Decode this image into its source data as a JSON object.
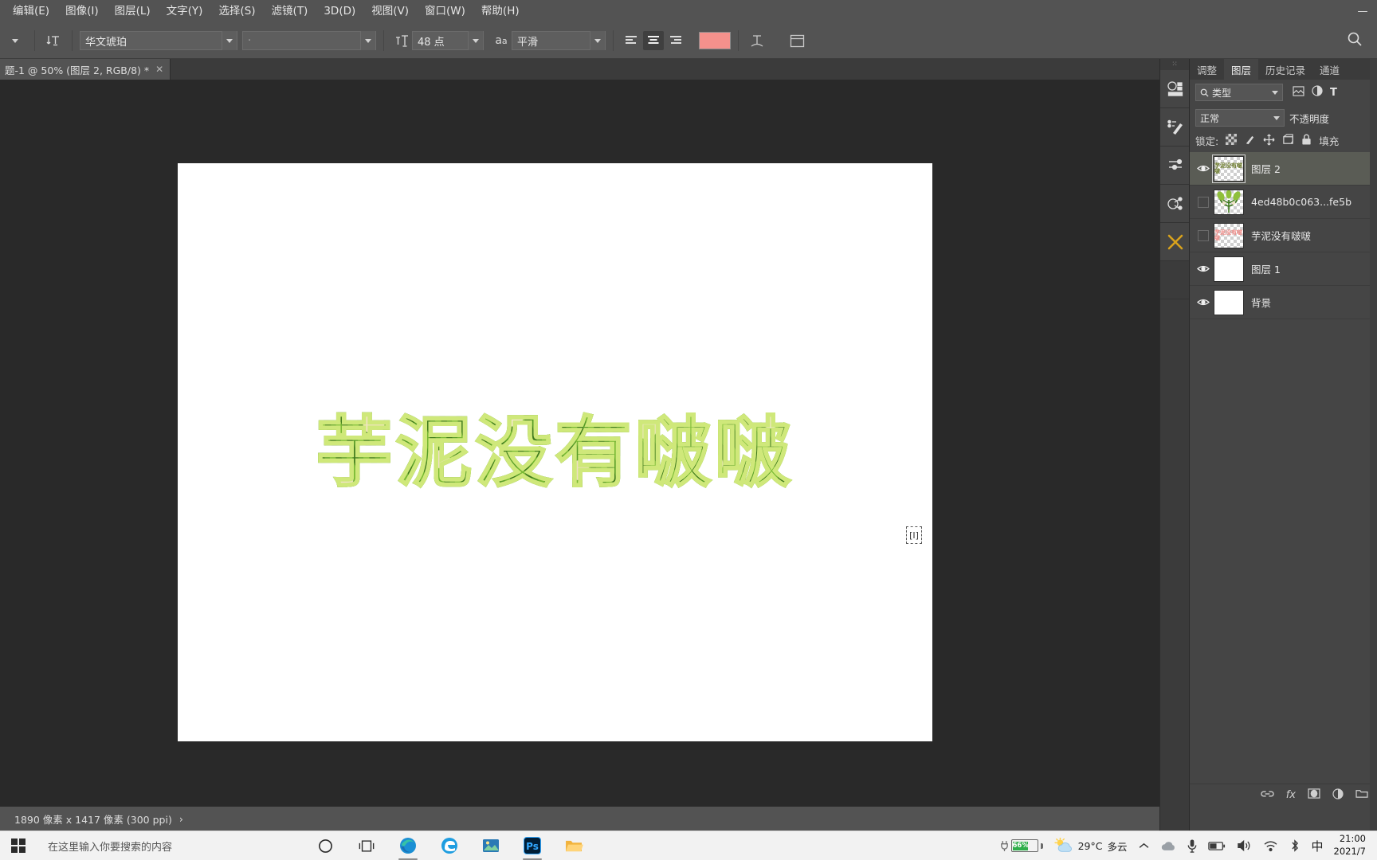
{
  "app": {
    "name": "Adobe Photoshop",
    "theme_bg": "#535353",
    "canvas_bg": "#292929"
  },
  "menubar": {
    "items": [
      {
        "label": "编辑(E)",
        "name": "menu-edit"
      },
      {
        "label": "图像(I)",
        "name": "menu-image"
      },
      {
        "label": "图层(L)",
        "name": "menu-layer"
      },
      {
        "label": "文字(Y)",
        "name": "menu-type"
      },
      {
        "label": "选择(S)",
        "name": "menu-select"
      },
      {
        "label": "滤镜(T)",
        "name": "menu-filter"
      },
      {
        "label": "3D(D)",
        "name": "menu-3d"
      },
      {
        "label": "视图(V)",
        "name": "menu-view"
      },
      {
        "label": "窗口(W)",
        "name": "menu-window"
      },
      {
        "label": "帮助(H)",
        "name": "menu-help"
      }
    ],
    "window_controls": {
      "minimize": "—",
      "maximize": "▢",
      "close": "✕"
    }
  },
  "options_bar": {
    "tool_preset_icon": "text-tool-icon",
    "preset_chevron": "chevron-down-icon",
    "orientation_icon": "text-orientation-icon",
    "font_family": "华文琥珀",
    "font_style": "·",
    "font_size_icon": "font-size-icon",
    "font_size": "48 点",
    "antialias_icon": "anti-alias-icon",
    "antialias": "平滑",
    "align": {
      "left": "align-left-icon",
      "center": "align-center-icon",
      "right": "align-right-icon",
      "active": "center"
    },
    "color": "#f4918c",
    "warp_icon": "warp-text-icon",
    "panels_icon": "toggle-panels-icon",
    "search_icon": "search-icon"
  },
  "document_tab": {
    "title": "题-1 @ 50% (图层 2, RGB/8) *",
    "close": "✕"
  },
  "canvas": {
    "artwork_text": "芋泥没有啵啵",
    "cursor_glyph": "[I]"
  },
  "status_bar": {
    "text": "1890 像素 x 1417 像素 (300 ppi)",
    "chevron": "›"
  },
  "tool_rail": {
    "grip": "⁙",
    "buttons": [
      {
        "name": "rail-3d-panel",
        "glyph": "◑"
      },
      {
        "name": "rail-brush-settings",
        "glyph": "✎"
      },
      {
        "name": "rail-adjustments",
        "glyph": "▤"
      },
      {
        "name": "rail-libraries",
        "glyph": "❂"
      },
      {
        "name": "rail-tools",
        "glyph": "✕"
      }
    ]
  },
  "layers_panel": {
    "tabs": [
      {
        "label": "调整",
        "name": "tab-adjustments",
        "active": false
      },
      {
        "label": "图层",
        "name": "tab-layers",
        "active": true
      },
      {
        "label": "历史记录",
        "name": "tab-history",
        "active": false
      },
      {
        "label": "通道",
        "name": "tab-channels",
        "active": false
      }
    ],
    "filter": {
      "search_icon": "search-icon",
      "kind_label": "类型",
      "chevron": "chevron-down-icon",
      "icons": [
        "image-filter-icon",
        "adjustment-filter-icon",
        "type-filter-icon"
      ]
    },
    "blend_mode": "正常",
    "opacity_label": "不透明度",
    "lock_label": "锁定:",
    "lock_icons": [
      "lock-transparent-icon",
      "lock-image-icon",
      "lock-position-icon",
      "lock-artboard-icon",
      "lock-all-icon"
    ],
    "fill_label": "填充",
    "layers": [
      {
        "name": "图层 2",
        "visible": true,
        "selected": true,
        "thumb": "text-thumb",
        "thumb_kind": "transparent"
      },
      {
        "name": "4ed48b0c063...fe5b",
        "visible": false,
        "selected": false,
        "thumb": "leaf-thumb",
        "thumb_kind": "transparent"
      },
      {
        "name": "芋泥没有啵啵",
        "visible": false,
        "selected": false,
        "thumb": "pink-text-thumb",
        "thumb_kind": "transparent"
      },
      {
        "name": "图层 1",
        "visible": true,
        "selected": false,
        "thumb": "white-thumb",
        "thumb_kind": "white"
      },
      {
        "name": "背景",
        "visible": true,
        "selected": false,
        "thumb": "white-thumb",
        "thumb_kind": "white"
      }
    ],
    "footer_icons": [
      "link-layers-icon",
      "fx-icon",
      "layer-mask-icon",
      "adjustment-layer-icon",
      "new-group-icon"
    ]
  },
  "taskbar": {
    "start_icon": "windows-start-icon",
    "search_placeholder": "在这里输入你要搜索的内容",
    "icons": [
      {
        "name": "cortana-icon",
        "glyph": "◯"
      },
      {
        "name": "task-view-icon",
        "glyph": "❑"
      },
      {
        "name": "edge-chromium-icon",
        "glyph": "◉"
      },
      {
        "name": "edge-legacy-icon",
        "glyph": "𝑒"
      },
      {
        "name": "photos-icon",
        "glyph": "▩"
      },
      {
        "name": "photoshop-icon",
        "glyph": "Ps"
      },
      {
        "name": "file-explorer-icon",
        "glyph": "🗀"
      }
    ],
    "tray": {
      "battery_percent": "66%",
      "weather_temp": "29°C",
      "weather_desc": "多云",
      "chevron": "⌃",
      "onedrive": "onedrive-icon",
      "mic": "microphone-icon",
      "battery_icon": "battery-icon",
      "volume": "volume-icon",
      "wifi": "wifi-icon",
      "bluetooth": "bluetooth-icon",
      "ime": "中",
      "time": "21:00",
      "date": "2021/7"
    }
  }
}
